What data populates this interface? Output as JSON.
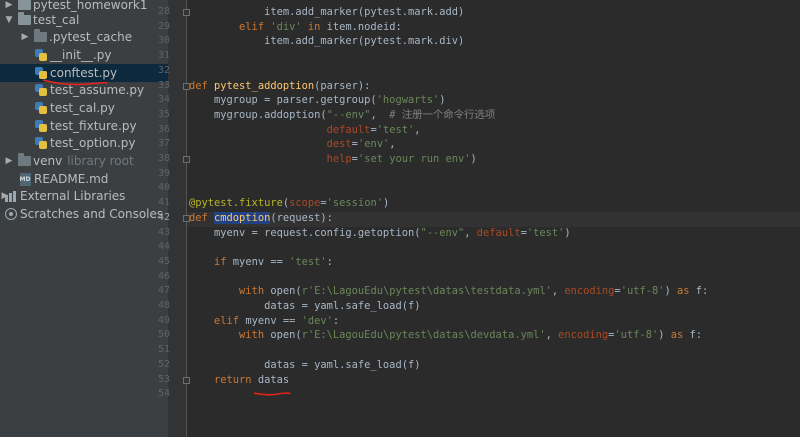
{
  "project_tree": {
    "items": [
      {
        "label": "pytest_homework1",
        "suffix": "",
        "type": "folder",
        "arrow": "▶",
        "indent": 0,
        "selected": false
      },
      {
        "label": "test_cal",
        "suffix": "",
        "type": "folder",
        "arrow": "▼",
        "indent": 0,
        "selected": false
      },
      {
        "label": ".pytest_cache",
        "suffix": "",
        "type": "folder-dark",
        "arrow": "▶",
        "indent": 1,
        "selected": false
      },
      {
        "label": "__init__.py",
        "suffix": "",
        "type": "py",
        "arrow": "",
        "indent": 1,
        "selected": false
      },
      {
        "label": "conftest.py",
        "suffix": "",
        "type": "py",
        "arrow": "",
        "indent": 1,
        "selected": true
      },
      {
        "label": "test_assume.py",
        "suffix": "",
        "type": "py",
        "arrow": "",
        "indent": 1,
        "selected": false
      },
      {
        "label": "test_cal.py",
        "suffix": "",
        "type": "py",
        "arrow": "",
        "indent": 1,
        "selected": false
      },
      {
        "label": "test_fixture.py",
        "suffix": "",
        "type": "py",
        "arrow": "",
        "indent": 1,
        "selected": false
      },
      {
        "label": "test_option.py",
        "suffix": "",
        "type": "py",
        "arrow": "",
        "indent": 1,
        "selected": false
      },
      {
        "label": "venv",
        "suffix": "library root",
        "type": "folder-dark",
        "arrow": "▶",
        "indent": 0,
        "selected": false
      },
      {
        "label": "README.md",
        "suffix": "",
        "type": "md",
        "arrow": "",
        "indent": 0,
        "selected": false
      },
      {
        "label": "External Libraries",
        "suffix": "",
        "type": "lib",
        "arrow": "▶",
        "indent": -1,
        "selected": false
      },
      {
        "label": "Scratches and Consoles",
        "suffix": "",
        "type": "scratch",
        "arrow": "",
        "indent": -1,
        "selected": false
      }
    ],
    "md_icon_text": "MD"
  },
  "editor": {
    "current_line": "42",
    "lines": [
      {
        "n": "28",
        "tokens": [
          {
            "t": "            item.add_marker(pytest.mark.add)"
          }
        ]
      },
      {
        "n": "29",
        "tokens": [
          {
            "t": "        "
          },
          {
            "t": "elif ",
            "c": "kw"
          },
          {
            "t": "'div'",
            "c": "st"
          },
          {
            "t": " "
          },
          {
            "t": "in",
            "c": "kw"
          },
          {
            "t": " item.nodeid:"
          }
        ]
      },
      {
        "n": "30",
        "tokens": [
          {
            "t": "            item.add_marker(pytest.mark.div)"
          }
        ]
      },
      {
        "n": "31",
        "tokens": []
      },
      {
        "n": "32",
        "tokens": []
      },
      {
        "n": "33",
        "tokens": [
          {
            "t": "def ",
            "c": "kw"
          },
          {
            "t": "pytest_addoption",
            "c": "fn"
          },
          {
            "t": "(parser):"
          }
        ]
      },
      {
        "n": "34",
        "tokens": [
          {
            "t": "    mygroup = parser.getgroup("
          },
          {
            "t": "'hogwarts'",
            "c": "st"
          },
          {
            "t": ")"
          }
        ]
      },
      {
        "n": "35",
        "tokens": [
          {
            "t": "    mygroup.addoption("
          },
          {
            "t": "\"--env\"",
            "c": "st"
          },
          {
            "t": ",  "
          },
          {
            "t": "# 注册一个命令行选项",
            "c": "cm"
          }
        ]
      },
      {
        "n": "36",
        "tokens": [
          {
            "t": "                      "
          },
          {
            "t": "default",
            "c": "pm"
          },
          {
            "t": "="
          },
          {
            "t": "'test'",
            "c": "st"
          },
          {
            "t": ","
          }
        ]
      },
      {
        "n": "37",
        "tokens": [
          {
            "t": "                      "
          },
          {
            "t": "dest",
            "c": "pm"
          },
          {
            "t": "="
          },
          {
            "t": "'env'",
            "c": "st"
          },
          {
            "t": ","
          }
        ]
      },
      {
        "n": "38",
        "tokens": [
          {
            "t": "                      "
          },
          {
            "t": "help",
            "c": "pm"
          },
          {
            "t": "="
          },
          {
            "t": "'set your run env'",
            "c": "st"
          },
          {
            "t": ")"
          }
        ]
      },
      {
        "n": "39",
        "tokens": []
      },
      {
        "n": "40",
        "tokens": []
      },
      {
        "n": "41",
        "tokens": [
          {
            "t": "@pytest.fixture",
            "c": "dc"
          },
          {
            "t": "("
          },
          {
            "t": "scope",
            "c": "pm"
          },
          {
            "t": "="
          },
          {
            "t": "'session'",
            "c": "st"
          },
          {
            "t": ")"
          }
        ]
      },
      {
        "n": "42",
        "tokens": [
          {
            "t": "def ",
            "c": "kw"
          },
          {
            "t": "cmdoption",
            "c": "fn sel"
          },
          {
            "t": "(request):"
          }
        ]
      },
      {
        "n": "43",
        "tokens": [
          {
            "t": "    myenv = request.config.getoption("
          },
          {
            "t": "\"--env\"",
            "c": "st"
          },
          {
            "t": ", "
          },
          {
            "t": "default",
            "c": "pm"
          },
          {
            "t": "="
          },
          {
            "t": "'test'",
            "c": "st"
          },
          {
            "t": ")"
          }
        ]
      },
      {
        "n": "44",
        "tokens": []
      },
      {
        "n": "45",
        "tokens": [
          {
            "t": "    "
          },
          {
            "t": "if",
            "c": "kw"
          },
          {
            "t": " myenv == "
          },
          {
            "t": "'test'",
            "c": "st"
          },
          {
            "t": ":"
          }
        ]
      },
      {
        "n": "46",
        "tokens": []
      },
      {
        "n": "47",
        "tokens": [
          {
            "t": "        "
          },
          {
            "t": "with",
            "c": "kw"
          },
          {
            "t": " open("
          },
          {
            "t": "r'E:\\LagouEdu\\pytest\\datas\\testdata.yml'",
            "c": "st"
          },
          {
            "t": ", "
          },
          {
            "t": "encoding",
            "c": "pm"
          },
          {
            "t": "="
          },
          {
            "t": "'utf-8'",
            "c": "st"
          },
          {
            "t": ") "
          },
          {
            "t": "as",
            "c": "kw"
          },
          {
            "t": " f:"
          }
        ]
      },
      {
        "n": "48",
        "tokens": [
          {
            "t": "            datas = yaml.safe_load(f)"
          }
        ]
      },
      {
        "n": "49",
        "tokens": [
          {
            "t": "    "
          },
          {
            "t": "elif",
            "c": "kw"
          },
          {
            "t": " myenv == "
          },
          {
            "t": "'dev'",
            "c": "st"
          },
          {
            "t": ":"
          }
        ]
      },
      {
        "n": "50",
        "tokens": [
          {
            "t": "        "
          },
          {
            "t": "with",
            "c": "kw"
          },
          {
            "t": " open("
          },
          {
            "t": "r'E:\\LagouEdu\\pytest\\datas\\devdata.yml'",
            "c": "st"
          },
          {
            "t": ", "
          },
          {
            "t": "encoding",
            "c": "pm"
          },
          {
            "t": "="
          },
          {
            "t": "'utf-8'",
            "c": "st"
          },
          {
            "t": ") "
          },
          {
            "t": "as",
            "c": "kw"
          },
          {
            "t": " f:"
          }
        ]
      },
      {
        "n": "51",
        "tokens": []
      },
      {
        "n": "52",
        "tokens": [
          {
            "t": "            datas = yaml.safe_load(f)"
          }
        ]
      },
      {
        "n": "53",
        "tokens": [
          {
            "t": "    "
          },
          {
            "t": "return",
            "c": "kw"
          },
          {
            "t": " datas"
          }
        ]
      },
      {
        "n": "54",
        "tokens": []
      }
    ]
  },
  "colors": {
    "editor_bg": "#2b2b2b",
    "sidebar_bg": "#3c3f41",
    "selection": "#0d293e",
    "keyword": "#cc7832",
    "string": "#6a8759",
    "function": "#ffc66d",
    "annotation_red": "#e0251b"
  }
}
